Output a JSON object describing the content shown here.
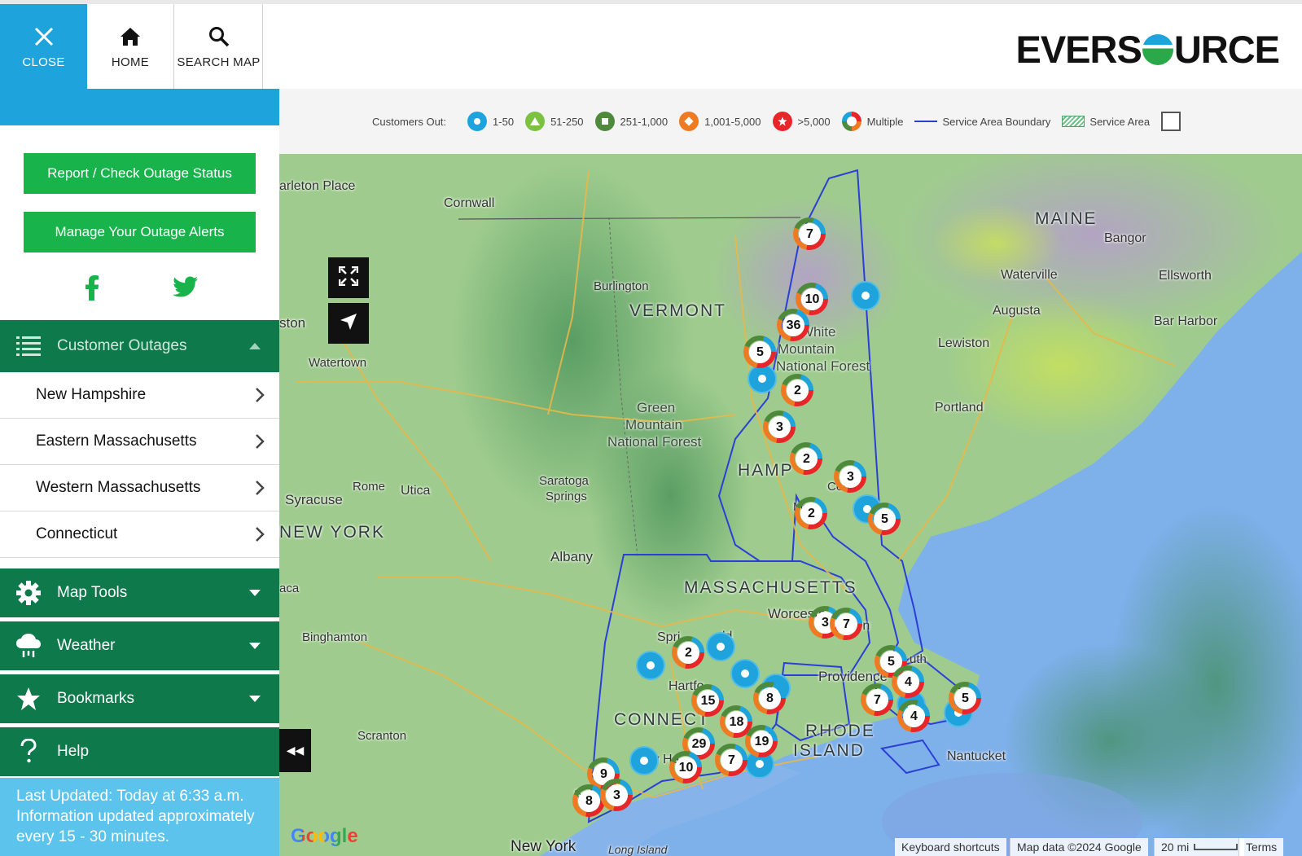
{
  "header": {
    "close_label": "CLOSE",
    "home_label": "HOME",
    "search_label": "SEARCH MAP",
    "logo_left": "EVERS",
    "logo_right": "URCE"
  },
  "sidebar": {
    "report_button": "Report / Check Outage Status",
    "alerts_button": "Manage Your Outage Alerts",
    "customer_outages": "Customer Outages",
    "regions": [
      {
        "label": "New Hampshire"
      },
      {
        "label": "Eastern Massachusetts"
      },
      {
        "label": "Western Massachusetts"
      },
      {
        "label": "Connecticut"
      }
    ],
    "map_tools": "Map Tools",
    "weather": "Weather",
    "bookmarks": "Bookmarks",
    "help": "Help",
    "updated_line1": "Last Updated: Today at 6:33 a.m.",
    "updated_line2": "Information updated approximately every 15 - 30 minutes."
  },
  "legend": {
    "title": "Customers Out:",
    "items": [
      {
        "label": "1-50",
        "color": "#1ea3dc"
      },
      {
        "label": "51-250",
        "color": "#7cc242"
      },
      {
        "label": "251-1,000",
        "color": "#4f8a3c"
      },
      {
        "label": "1,001-5,000",
        "color": "#f07a22"
      },
      {
        "label": ">5,000",
        "color": "#e8262a"
      },
      {
        "label": "Multiple",
        "color": "multi"
      },
      {
        "label": "Service Area Boundary",
        "color": "#2b3fd6"
      },
      {
        "label": "Service Area",
        "color": "#9ad0a0"
      }
    ]
  },
  "map": {
    "labels": {
      "maine": "MAINE",
      "vermont": "VERMONT",
      "new_hampshire": "HAMP",
      "new_york": "NEW YORK",
      "massachusetts": "MASSACHUSETTS",
      "connecticut": "CONNECT",
      "rhode_island_1": "RHODE",
      "rhode_island_2": "ISLAND",
      "white_mountain_1": "White",
      "white_mountain_2": "Mountain",
      "white_mountain_3": "National Forest",
      "green_mountain_1": "Green",
      "green_mountain_2": "Mountain",
      "green_mountain_3": "National Forest",
      "burlington": "Burlington",
      "cornwall": "Cornwall",
      "carleton": "arleton Place",
      "kingston": "ston",
      "watertown": "Watertown",
      "syracuse": "Syracuse",
      "rome": "Rome",
      "utica": "Utica",
      "saratoga_1": "Saratoga",
      "saratoga_2": "Springs",
      "albany": "Albany",
      "binghamton": "Binghamton",
      "ithaca": "aca",
      "scranton": "Scranton",
      "worcester": "Worceste",
      "springfield": "Spri",
      "springfield_2": "ld",
      "hartford": "Hartfo",
      "providence": "Providence",
      "new_haven": "w Ha",
      "new_york_city": "New York",
      "long_island": "Long Island",
      "nantucket": "Nantucket",
      "portland": "Portland",
      "lewiston": "Lewiston",
      "augusta": "Augusta",
      "waterville": "Waterville",
      "bangor": "Bangor",
      "ellsworth": "Ellsworth",
      "bar_harbor": "Bar Harbor",
      "concord": "Con",
      "manchester": "Ma",
      "boston": "ton",
      "plymouth": "uth",
      "s_label": "S"
    },
    "markers": [
      {
        "count": "7"
      },
      {
        "count": "10"
      },
      {
        "count": "36"
      },
      {
        "count": "5"
      },
      {
        "count": "2"
      },
      {
        "count": "3"
      },
      {
        "count": "2"
      },
      {
        "count": "3"
      },
      {
        "count": "2"
      },
      {
        "count": "5"
      },
      {
        "count": "3"
      },
      {
        "count": "7"
      },
      {
        "count": "2"
      },
      {
        "count": "15"
      },
      {
        "count": "8"
      },
      {
        "count": "18"
      },
      {
        "count": "19"
      },
      {
        "count": "29"
      },
      {
        "count": "10"
      },
      {
        "count": "7"
      },
      {
        "count": "5"
      },
      {
        "count": "4"
      },
      {
        "count": "7"
      },
      {
        "count": "4"
      },
      {
        "count": "5"
      },
      {
        "count": "9"
      },
      {
        "count": "8"
      },
      {
        "count": "3"
      }
    ],
    "google": "Google",
    "keyboard_shortcuts": "Keyboard shortcuts",
    "map_data": "Map data ©2024 Google",
    "scale": "20 mi",
    "terms": "Terms",
    "collapse_glyph": "◀◀"
  }
}
